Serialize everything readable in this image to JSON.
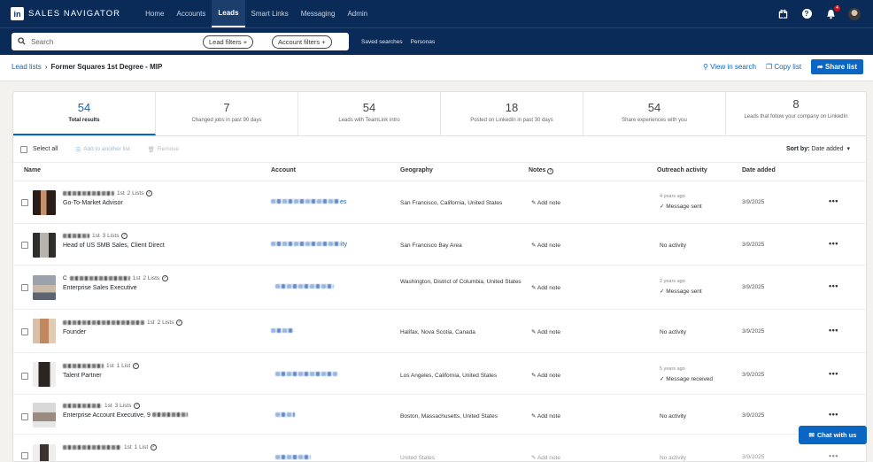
{
  "nav": {
    "logo_mark": "in",
    "brand": "SALES NAVIGATOR",
    "links": [
      {
        "label": "Home",
        "active": false
      },
      {
        "label": "Accounts",
        "active": false
      },
      {
        "label": "Leads",
        "active": true
      },
      {
        "label": "Smart Links",
        "active": false
      },
      {
        "label": "Messaging",
        "active": false
      },
      {
        "label": "Admin",
        "active": false
      }
    ],
    "icons": [
      "gift-icon",
      "help-icon",
      "notifications-icon",
      "profile-avatar"
    ],
    "notification_count": "4"
  },
  "search": {
    "placeholder": "Search",
    "lead_filters": "Lead filters",
    "account_filters": "Account filters",
    "saved_searches": "Saved searches",
    "personas": "Personas"
  },
  "breadcrumb": {
    "parent": "Lead lists",
    "separator": "›",
    "current": "Former Squares 1st Degree - MIP"
  },
  "actions": {
    "view_in_search": "View in search",
    "copy_list": "Copy list",
    "share_list": "Share list"
  },
  "stats": [
    {
      "num": "54",
      "label": "Total results",
      "active": true
    },
    {
      "num": "7",
      "label": "Changed jobs in past 90 days",
      "active": false
    },
    {
      "num": "54",
      "label": "Leads with TeamLink intro",
      "active": false
    },
    {
      "num": "18",
      "label": "Posted on LinkedIn in past 30 days",
      "active": false
    },
    {
      "num": "54",
      "label": "Share experiences with you",
      "active": false
    },
    {
      "num": "8",
      "label": "Leads that follow your company on LinkedIn",
      "active": false
    }
  ],
  "toolbar": {
    "select_all": "Select all",
    "add_to_another_list": "Add to another list",
    "remove": "Remove",
    "sort_by_label": "Sort by:",
    "sort_by_value": "Date added"
  },
  "columns": {
    "name": "Name",
    "account": "Account",
    "geography": "Geography",
    "notes": "Notes",
    "outreach": "Outreach activity",
    "date_added": "Date added"
  },
  "rows": [
    {
      "degree": "1st",
      "lists": "2 Lists",
      "title": "Go-To-Market Advisor",
      "account_tail": "es",
      "geography": "San Francisco, California, United States",
      "note": "Add note",
      "outreach_ago": "4 years ago",
      "outreach": "Message sent",
      "date": "3/9/2025"
    },
    {
      "degree": "1st",
      "lists": "3 Lists",
      "title": "Head of US SMB Sales, Client Direct",
      "account_tail": "ity",
      "geography": "San Francisco Bay Area",
      "note": "Add note",
      "outreach_ago": "",
      "outreach": "No activity",
      "date": "3/9/2025"
    },
    {
      "name_initial": "C",
      "degree": "1st",
      "lists": "2 Lists",
      "title": "Enterprise Sales Executive",
      "account_tail": "",
      "geography": "Washington, District of Columbia, United States",
      "note": "Add note",
      "outreach_ago": "2 years ago",
      "outreach": "Message sent",
      "date": "3/9/2025"
    },
    {
      "degree": "1st",
      "lists": "2 Lists",
      "title": "Founder",
      "account_tail": "",
      "geography": "Halifax, Nova Scotia, Canada",
      "note": "Add note",
      "outreach_ago": "",
      "outreach": "No activity",
      "date": "3/9/2025"
    },
    {
      "degree": "1st",
      "lists": "1 List",
      "title": "Talent Partner",
      "account_tail": "",
      "geography": "Los Angeles, California, United States",
      "note": "Add note",
      "outreach_ago": "5 years ago",
      "outreach": "Message received",
      "date": "3/9/2025"
    },
    {
      "degree": "1st",
      "lists": "3 Lists",
      "title": "Enterprise Account Executive, 9",
      "account_tail": "",
      "geography": "Boston, Massachusetts, United States",
      "note": "Add note",
      "outreach_ago": "",
      "outreach": "No activity",
      "date": "3/9/2025"
    },
    {
      "degree": "1st",
      "lists": "1 List",
      "title": "",
      "account_tail": "",
      "geography": "United States",
      "note": "Add note",
      "outreach_ago": "",
      "outreach": "No activity",
      "date": "3/9/2025"
    }
  ],
  "chat": {
    "label": "Chat with us"
  },
  "colors": {
    "nav_bg": "#0a2b57",
    "accent": "#0a66c2",
    "page_bg": "#f3f2ef"
  }
}
